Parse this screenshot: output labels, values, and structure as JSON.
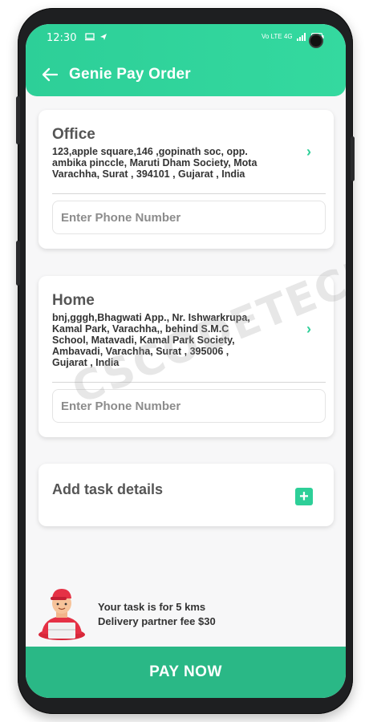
{
  "status_bar": {
    "time": "12:30",
    "right_text": "Vo LTE 4G"
  },
  "header": {
    "title": "Genie Pay Order"
  },
  "office": {
    "title": "Office",
    "address_lines": [
      "123,apple square,146 ,gopinath soc, opp.",
      "ambika pinccle, Maruti Dham Society, Mota",
      "Varachha,  Surat , 394101 , Gujarat , India"
    ],
    "phone_placeholder": "Enter Phone Number"
  },
  "home": {
    "title": "Home",
    "address_lines": [
      "bnj,gggh,Bhagwati App., Nr. Ishwarkrupa,",
      "Kamal Park, Varachha,, behind S.M.C",
      "School, Matavadi, Kamal Park Society,",
      "Ambavadi, Varachha,  Surat , 395006 ,",
      "Gujarat , India"
    ],
    "phone_placeholder": "Enter Phone Number"
  },
  "task": {
    "title": "Add task details",
    "add_symbol": "+"
  },
  "delivery": {
    "distance_text": "Your task is for 5 kms",
    "fee_text": "Delivery partner fee $30"
  },
  "pay_button": {
    "label": "PAY NOW"
  },
  "watermark": {
    "text": "CSCODETECH"
  },
  "colors": {
    "accent": "#2dcf98",
    "pay": "#2ab886"
  }
}
